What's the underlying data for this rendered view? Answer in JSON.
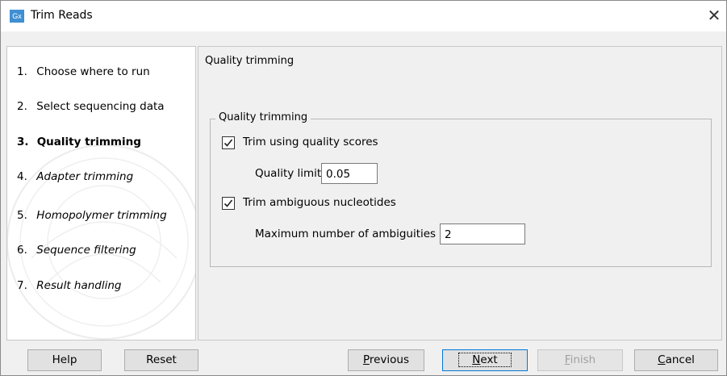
{
  "window": {
    "title": "Trim Reads",
    "app_icon_text": "Gx",
    "close_glyph": "✕"
  },
  "steps": [
    {
      "num": "1.",
      "label": "Choose where to run",
      "state": "done"
    },
    {
      "num": "2.",
      "label": "Select sequencing data",
      "state": "done"
    },
    {
      "num": "3.",
      "label": "Quality trimming",
      "state": "current"
    },
    {
      "num": "4.",
      "label": "Adapter trimming",
      "state": "future"
    },
    {
      "num": "5.",
      "label": "Homopolymer trimming",
      "state": "future"
    },
    {
      "num": "6.",
      "label": "Sequence filtering",
      "state": "future"
    },
    {
      "num": "7.",
      "label": "Result handling",
      "state": "future"
    }
  ],
  "content": {
    "section_title": "Quality trimming",
    "group_title": "Quality trimming",
    "trim_quality": {
      "label": "Trim using quality scores",
      "checked": true
    },
    "quality_limit": {
      "label": "Quality limit",
      "value": "0.05"
    },
    "trim_ambiguous": {
      "label": "Trim ambiguous nucleotides",
      "checked": true
    },
    "max_ambiguities": {
      "label": "Maximum number of ambiguities",
      "value": "2"
    }
  },
  "buttons": {
    "help": {
      "pre": "",
      "mn": "",
      "post": "Help"
    },
    "reset": {
      "pre": "",
      "mn": "",
      "post": "Reset"
    },
    "previous": {
      "pre": "",
      "mn": "P",
      "post": "revious"
    },
    "next": {
      "pre": "",
      "mn": "N",
      "post": "ext"
    },
    "finish": {
      "pre": "",
      "mn": "F",
      "post": "inish"
    },
    "cancel": {
      "pre": "",
      "mn": "C",
      "post": "ancel"
    }
  },
  "colors": {
    "accent": "#0078d7",
    "icon_bg": "#3f8fd2"
  }
}
